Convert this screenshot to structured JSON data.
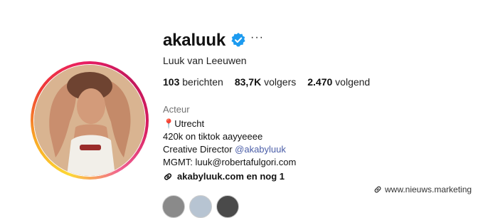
{
  "profile": {
    "username": "akaluuk",
    "more_label": "···",
    "full_name": "Luuk van Leeuwen",
    "stats": [
      {
        "value": "103",
        "label": "berichten"
      },
      {
        "value": "83,7K",
        "label": "volgers"
      },
      {
        "value": "2.470",
        "label": "volgend"
      }
    ],
    "category": "Acteur",
    "bio": {
      "line1_emoji": "📍",
      "line1_text": "Utrecht",
      "line2": "420k on tiktok aayyeeee",
      "line3_prefix": "Creative Director ",
      "line3_mention": "@akabyluuk",
      "line4": "MGMT: luuk@robertafulgori.com"
    },
    "link_text": "akabyluuk.com en nog 1"
  },
  "watermark": {
    "text": "www.nieuws.marketing"
  },
  "colors": {
    "verified": "#1d9bf0",
    "mention": "#4b5ea8",
    "category": "#737373"
  },
  "icons": {
    "verified": "verified-badge-icon",
    "link": "link-icon",
    "pin": "pin-icon",
    "more": "more-icon"
  }
}
